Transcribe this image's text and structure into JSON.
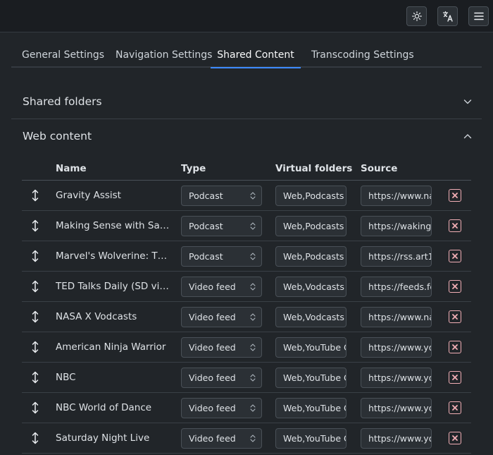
{
  "tabs": [
    {
      "label": "General Settings"
    },
    {
      "label": "Navigation Settings"
    },
    {
      "label": "Shared Content"
    },
    {
      "label": "Transcoding Settings"
    }
  ],
  "sections": {
    "shared_folders": {
      "title": "Shared folders"
    },
    "web_content": {
      "title": "Web content"
    }
  },
  "table": {
    "headers": {
      "name": "Name",
      "type": "Type",
      "virtual_folders": "Virtual folders",
      "source": "Source"
    },
    "rows": [
      {
        "name": "Gravity Assist",
        "type": "Podcast",
        "folders": "Web,Podcasts",
        "source": "https://www.na"
      },
      {
        "name": "Making Sense with Sam Harris",
        "type": "Podcast",
        "folders": "Web,Podcasts",
        "source": "https://wakingu"
      },
      {
        "name": "Marvel's Wolverine: The Long Night",
        "type": "Podcast",
        "folders": "Web,Podcasts",
        "source": "https://rss.art19"
      },
      {
        "name": "TED Talks Daily (SD video)",
        "type": "Video feed",
        "folders": "Web,Vodcasts",
        "source": "https://feeds.fe"
      },
      {
        "name": "NASA X Vodcasts",
        "type": "Video feed",
        "folders": "Web,Vodcasts",
        "source": "https://www.na"
      },
      {
        "name": "American Ninja Warrior",
        "type": "Video feed",
        "folders": "Web,YouTube C",
        "source": "https://www.yo"
      },
      {
        "name": "NBC",
        "type": "Video feed",
        "folders": "Web,YouTube C",
        "source": "https://www.yo"
      },
      {
        "name": "NBC World of Dance",
        "type": "Video feed",
        "folders": "Web,YouTube C",
        "source": "https://www.yo"
      },
      {
        "name": "Saturday Night Live",
        "type": "Video feed",
        "folders": "Web,YouTube C",
        "source": "https://www.yo"
      }
    ]
  }
}
